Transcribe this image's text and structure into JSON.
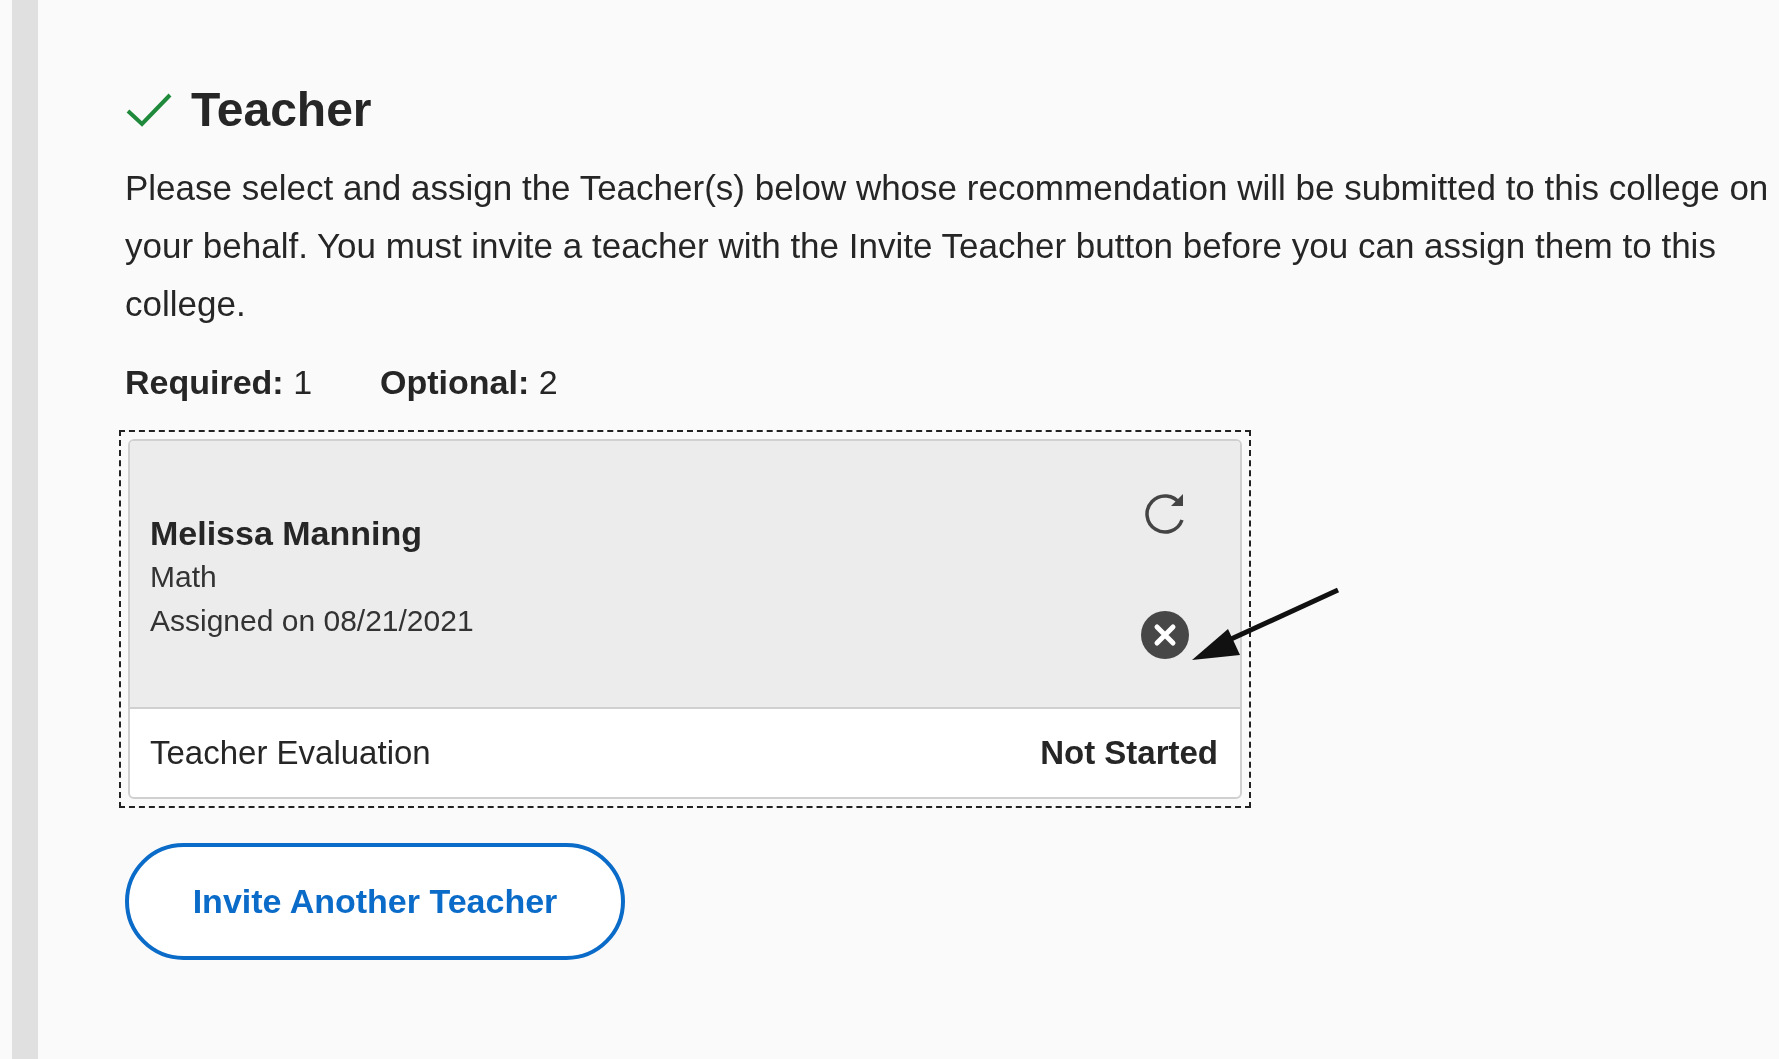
{
  "section": {
    "title": "Teacher",
    "complete": true,
    "description": "Please select and assign the Teacher(s) below whose recommendation will be submitted to this college on your behalf. You must invite a teacher with the Invite Teacher button before you can assign them to this college.",
    "counts": [
      {
        "label": "Required:",
        "value": "1"
      },
      {
        "label": "Optional:",
        "value": "2"
      }
    ],
    "teachers": [
      {
        "name": "Melissa Manning",
        "subject": "Math",
        "assigned": "Assigned on 08/21/2021",
        "focused": true,
        "form": "Teacher Evaluation",
        "status": "Not Started"
      }
    ],
    "invite_button": "Invite Another Teacher"
  }
}
